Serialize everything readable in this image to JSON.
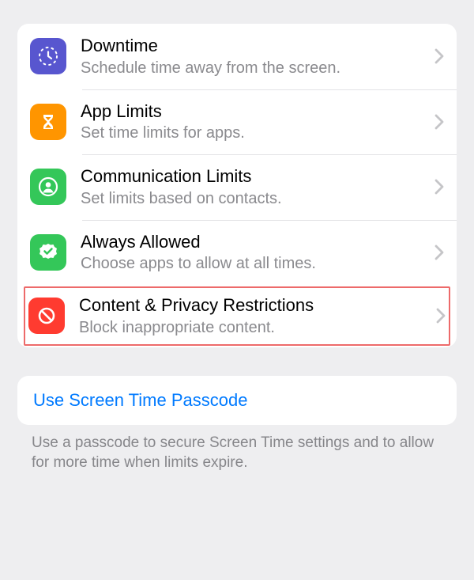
{
  "settings": {
    "items": [
      {
        "title": "Downtime",
        "subtitle": "Schedule time away from the screen.",
        "icon": "downtime-icon",
        "color": "purple",
        "highlighted": false
      },
      {
        "title": "App Limits",
        "subtitle": "Set time limits for apps.",
        "icon": "hourglass-icon",
        "color": "orange",
        "highlighted": false
      },
      {
        "title": "Communication Limits",
        "subtitle": "Set limits based on contacts.",
        "icon": "contact-icon",
        "color": "green",
        "highlighted": false
      },
      {
        "title": "Always Allowed",
        "subtitle": "Choose apps to allow at all times.",
        "icon": "checkmark-seal-icon",
        "color": "green",
        "highlighted": false
      },
      {
        "title": "Content & Privacy Restrictions",
        "subtitle": "Block inappropriate content.",
        "icon": "no-symbol-icon",
        "color": "red",
        "highlighted": true
      }
    ]
  },
  "passcode": {
    "link_label": "Use Screen Time Passcode",
    "footer": "Use a passcode to secure Screen Time settings and to allow for more time when limits expire."
  }
}
